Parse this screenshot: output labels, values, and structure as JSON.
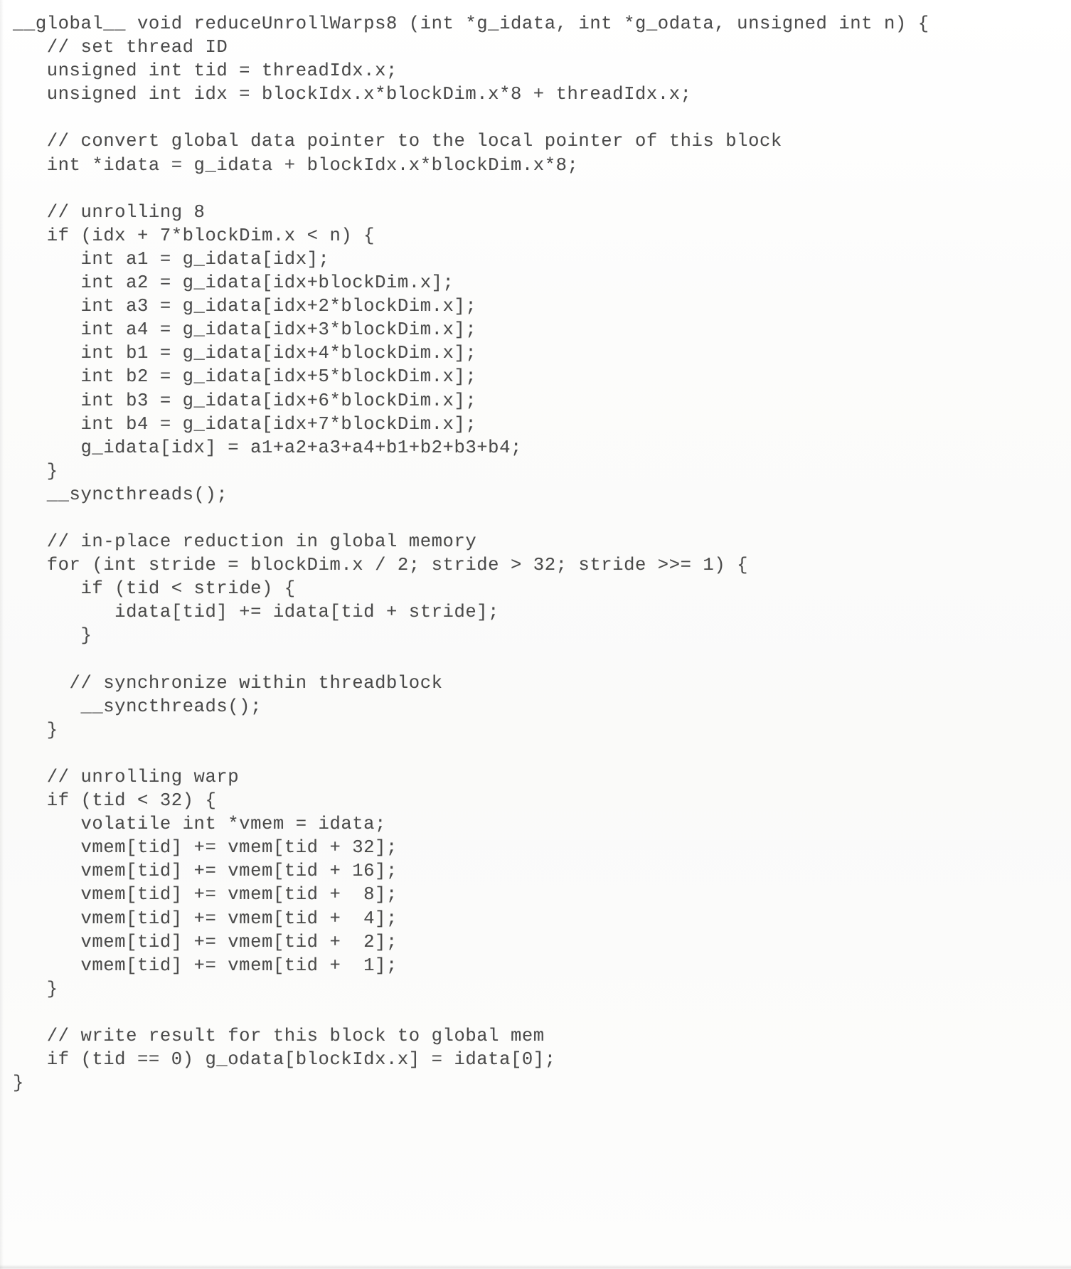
{
  "document": {
    "type": "code-listing",
    "language": "CUDA C",
    "kernel_name": "reduceUnrollWarps8",
    "background_color": "#fbfbfa",
    "text_color": "#3b3b3b",
    "font_style": "monospace-serif-courier",
    "line_count": 48
  },
  "code": {
    "lines": [
      "__global__ void reduceUnrollWarps8 (int *g_idata, int *g_odata, unsigned int n) {",
      "   // set thread ID",
      "   unsigned int tid = threadIdx.x;",
      "   unsigned int idx = blockIdx.x*blockDim.x*8 + threadIdx.x;",
      "",
      "   // convert global data pointer to the local pointer of this block",
      "   int *idata = g_idata + blockIdx.x*blockDim.x*8;",
      "",
      "   // unrolling 8",
      "   if (idx + 7*blockDim.x < n) {",
      "      int a1 = g_idata[idx];",
      "      int a2 = g_idata[idx+blockDim.x];",
      "      int a3 = g_idata[idx+2*blockDim.x];",
      "      int a4 = g_idata[idx+3*blockDim.x];",
      "      int b1 = g_idata[idx+4*blockDim.x];",
      "      int b2 = g_idata[idx+5*blockDim.x];",
      "      int b3 = g_idata[idx+6*blockDim.x];",
      "      int b4 = g_idata[idx+7*blockDim.x];",
      "      g_idata[idx] = a1+a2+a3+a4+b1+b2+b3+b4;",
      "   }",
      "   __syncthreads();",
      "",
      "   // in-place reduction in global memory",
      "   for (int stride = blockDim.x / 2; stride > 32; stride >>= 1) {",
      "      if (tid < stride) {",
      "         idata[tid] += idata[tid + stride];",
      "      }",
      "",
      "     // synchronize within threadblock",
      "      __syncthreads();",
      "   }",
      "",
      "   // unrolling warp",
      "   if (tid < 32) {",
      "      volatile int *vmem = idata;",
      "      vmem[tid] += vmem[tid + 32];",
      "      vmem[tid] += vmem[tid + 16];",
      "      vmem[tid] += vmem[tid +  8];",
      "      vmem[tid] += vmem[tid +  4];",
      "      vmem[tid] += vmem[tid +  2];",
      "      vmem[tid] += vmem[tid +  1];",
      "   }",
      "",
      "   // write result for this block to global mem",
      "   if (tid == 0) g_odata[blockIdx.x] = idata[0];",
      "}"
    ]
  }
}
